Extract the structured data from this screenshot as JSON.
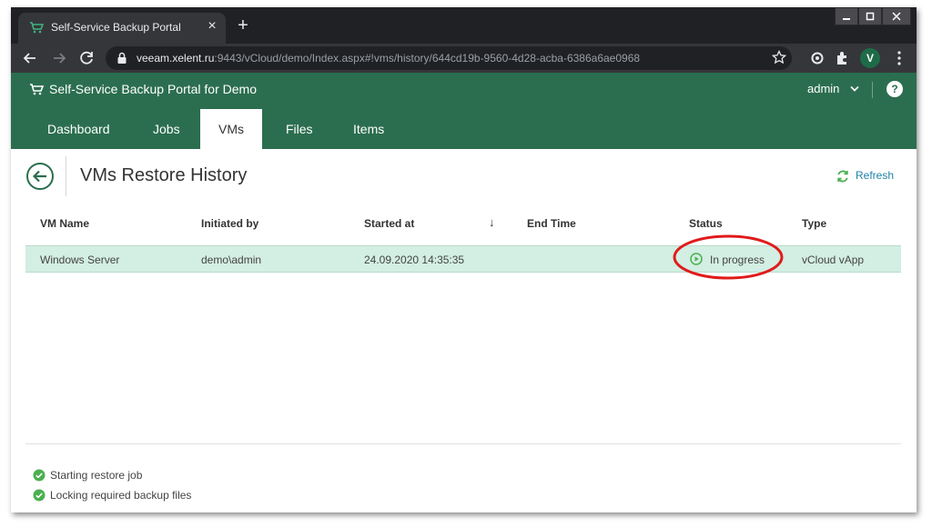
{
  "browser": {
    "tab_title": "Self-Service Backup Portal",
    "url_host": "veeam.xelent.ru",
    "url_rest": ":9443/vCloud/demo/Index.aspx#!vms/history/644cd19b-9560-4d28-acba-6386a6ae0968",
    "profile_initial": "V"
  },
  "app": {
    "title": "Self-Service Backup Portal for Demo",
    "user": "admin",
    "nav": [
      "Dashboard",
      "Jobs",
      "VMs",
      "Files",
      "Items"
    ],
    "active_tab": "VMs",
    "brand_color": "#2b6e4f"
  },
  "page": {
    "title": "VMs Restore History",
    "refresh_label": "Refresh"
  },
  "table": {
    "columns": [
      "VM Name",
      "Initiated by",
      "Started at",
      "End Time",
      "Status",
      "Type"
    ],
    "sort_column": "Started at",
    "rows": [
      {
        "vm_name": "Windows Server",
        "initiated_by": "demo\\admin",
        "started_at": "24.09.2020 14:35:35",
        "end_time": "",
        "status": "In progress",
        "type": "vCloud vApp"
      }
    ]
  },
  "log": [
    "Starting restore job",
    "Locking required backup files"
  ],
  "colors": {
    "selected_row": "#d3eee3",
    "success": "#4caf50",
    "highlight_ring": "#e01b1b",
    "link": "#1f82a8"
  }
}
